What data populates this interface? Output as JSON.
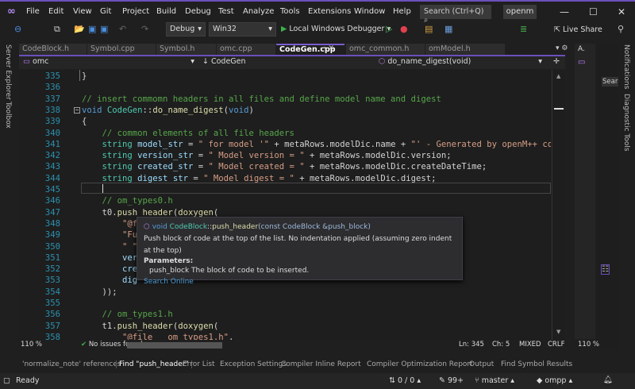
{
  "menu": [
    "File",
    "Edit",
    "View",
    "Git",
    "Project",
    "Build",
    "Debug",
    "Test",
    "Analyze",
    "Tools",
    "Extensions",
    "Window",
    "Help"
  ],
  "search": "Search (Ctrl+Q)",
  "solution": "openm",
  "toolbar": {
    "config": "Debug",
    "platform": "Win32",
    "run": "Local Windows Debugger",
    "live_share": "Live Share"
  },
  "left_strip": [
    "Server Explorer",
    "Toolbox"
  ],
  "tabs": [
    "CodeBlock.h",
    "Symbol.cpp",
    "Symbol.h",
    "omc.cpp",
    "CodeGen.cpp",
    "omc_common.h",
    "omModel.h"
  ],
  "active_tab": "CodeGen.cpp",
  "nav": {
    "project": "omc",
    "scope": "CodeGen",
    "member": "do_name_digest(void)"
  },
  "code": [
    {
      "n": "335",
      "t": [
        [
          "pl",
          "}"
        ]
      ]
    },
    {
      "n": "336",
      "t": []
    },
    {
      "n": "337",
      "t": [
        [
          "cm",
          "// insert commomn headers in all files and define model name and digest"
        ]
      ]
    },
    {
      "n": "338",
      "t": [
        [
          "kw",
          "void "
        ],
        [
          "ty",
          "CodeGen"
        ],
        [
          "pl",
          "::"
        ],
        [
          "fn",
          "do_name_digest"
        ],
        [
          "pl",
          "("
        ],
        [
          "kw",
          "void"
        ],
        [
          "pl",
          ")"
        ]
      ]
    },
    {
      "n": "339",
      "t": [
        [
          "pl",
          "{"
        ]
      ]
    },
    {
      "n": "340",
      "t": [
        [
          "cm",
          "    // common elements of all file headers"
        ]
      ]
    },
    {
      "n": "341",
      "t": [
        [
          "ty",
          "    string "
        ],
        [
          "va",
          "model_str"
        ],
        [
          "pl",
          " = "
        ],
        [
          "st",
          "\" for model '\""
        ],
        [
          "pl",
          " + metaRows.modelDic.name + "
        ],
        [
          "st",
          "\"' - Generated by openM++ co"
        ]
      ]
    },
    {
      "n": "342",
      "t": [
        [
          "ty",
          "    string "
        ],
        [
          "va",
          "version_str"
        ],
        [
          "pl",
          " = "
        ],
        [
          "st",
          "\" Model version = \""
        ],
        [
          "pl",
          " + metaRows.modelDic.version;"
        ]
      ]
    },
    {
      "n": "343",
      "t": [
        [
          "ty",
          "    string "
        ],
        [
          "va",
          "created_str"
        ],
        [
          "pl",
          " = "
        ],
        [
          "st",
          "\" Model created = \""
        ],
        [
          "pl",
          " + metaRows.modelDic.createDateTime;"
        ]
      ]
    },
    {
      "n": "344",
      "t": [
        [
          "ty",
          "    string "
        ],
        [
          "va",
          "digest_str"
        ],
        [
          "pl",
          " = "
        ],
        [
          "st",
          "\" Model digest = \""
        ],
        [
          "pl",
          " + metaRows.modelDic.digest;"
        ]
      ]
    },
    {
      "n": "345",
      "t": []
    },
    {
      "n": "346",
      "t": [
        [
          "cm",
          "    // om_types0.h"
        ]
      ]
    },
    {
      "n": "347",
      "t": [
        [
          "pl",
          "    t0."
        ],
        [
          "fn",
          "push_header"
        ],
        [
          "pl",
          "("
        ],
        [
          "fn",
          "doxygen"
        ],
        [
          "pl",
          "("
        ]
      ]
    },
    {
      "n": "348",
      "t": [
        [
          "st",
          "        \"@f"
        ]
      ]
    },
    {
      "n": "349",
      "t": [
        [
          "st",
          "        \"Fu"
        ]
      ]
    },
    {
      "n": "350",
      "t": [
        [
          "st",
          "        \" \""
        ]
      ]
    },
    {
      "n": "351",
      "t": [
        [
          "va",
          "        ver"
        ]
      ]
    },
    {
      "n": "352",
      "t": [
        [
          "va",
          "        cre"
        ]
      ]
    },
    {
      "n": "353",
      "t": [
        [
          "va",
          "        dig"
        ]
      ]
    },
    {
      "n": "354",
      "t": [
        [
          "pl",
          "    ));"
        ]
      ]
    },
    {
      "n": "355",
      "t": []
    },
    {
      "n": "356",
      "t": [
        [
          "cm",
          "    // om_types1.h"
        ]
      ]
    },
    {
      "n": "357",
      "t": [
        [
          "pl",
          "    t1."
        ],
        [
          "fn",
          "push_header"
        ],
        [
          "pl",
          "("
        ],
        [
          "fn",
          "doxygen"
        ],
        [
          "pl",
          "("
        ]
      ]
    },
    {
      "n": "358",
      "t": [
        [
          "st",
          "        \"@file   om_types1.h\""
        ],
        [
          "pl",
          ","
        ]
      ]
    }
  ],
  "tooltip": {
    "ret": "void",
    "cls": "CodeBlock",
    "fn": "push_header",
    "params": "(const CodeBlock &push_block)",
    "desc": "Push block of code at the top of the list. No indentation applied (assuming zero indent at the top)",
    "params_label": "Parameters:",
    "param_desc": "push_block The block of code to be inserted.",
    "search_link": "Search Online"
  },
  "editor_status": {
    "zoom": "110 %",
    "issues": "No issues found",
    "ln": "Ln: 345",
    "ch": "Ch: 5",
    "enc": "MIXED",
    "eol": "CRLF",
    "zoom2": "110 %"
  },
  "panel_tabs": [
    "'normalize_note' references",
    "Find \"push_header\"",
    "Error List",
    "Exception Settings",
    "Compiler Inline Report",
    "Compiler Optimization Report",
    "Output",
    "Find Symbol Results"
  ],
  "status": {
    "ready": "Ready",
    "changes": "0 / 0",
    "edits": "99+",
    "branch": "master",
    "repo": "ompp"
  },
  "right_strip": [
    "Notifications",
    "Diagnostic Tools"
  ],
  "right_pane": {
    "label": "A.",
    "search": "Sear"
  }
}
